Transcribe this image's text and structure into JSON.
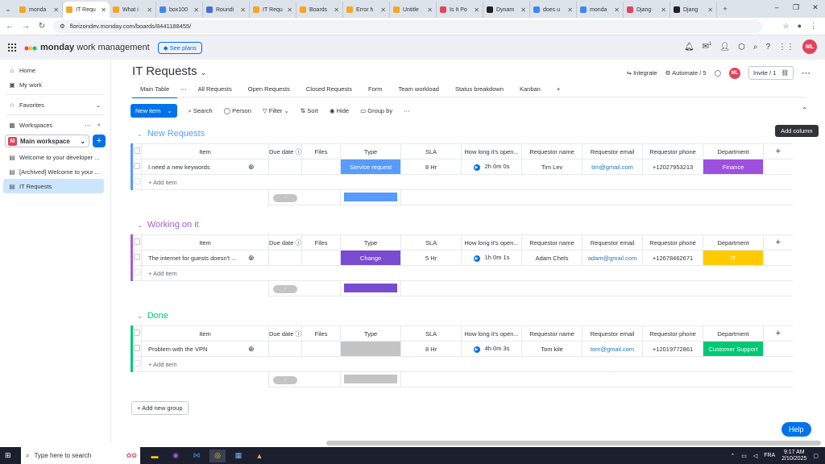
{
  "browser": {
    "tabs": [
      {
        "label": "monda",
        "color": "#f5a623"
      },
      {
        "label": "IT Requ",
        "color": "#f5a623",
        "active": true
      },
      {
        "label": "What i",
        "color": "#f5a623"
      },
      {
        "label": "box100",
        "color": "#4285f4"
      },
      {
        "label": "Roundi",
        "color": "#4b6bd6"
      },
      {
        "label": "IT Requ",
        "color": "#f5a623"
      },
      {
        "label": "Boards",
        "color": "#f5a623"
      },
      {
        "label": "Error h",
        "color": "#f5a623"
      },
      {
        "label": "Untitle",
        "color": "#f5a623"
      },
      {
        "label": "Is It Po",
        "color": "#e2445c"
      },
      {
        "label": "Dynam",
        "color": "#222"
      },
      {
        "label": "does u",
        "color": "#4285f4"
      },
      {
        "label": "monda",
        "color": "#4285f4"
      },
      {
        "label": "Djang",
        "color": "#e2445c"
      },
      {
        "label": "Djang",
        "color": "#222"
      }
    ],
    "url": "florizondev.monday.com/boards/8441188455/"
  },
  "app": {
    "logo_word": "monday",
    "logo_rest": "work management",
    "see_plans": "See plans",
    "avatar": "ML",
    "updates_badge": "1"
  },
  "sidebar": {
    "home": "Home",
    "my_work": "My work",
    "favorites": "Favorites",
    "workspaces": "Workspaces",
    "workspace": "Main workspace",
    "workspace_initial": "M",
    "boards": [
      "Welcome to your developer ...",
      "[Archived] Welcome to your ...",
      "IT Requests"
    ]
  },
  "board": {
    "title": "IT Requests",
    "integrate": "Integrate",
    "automate": "Automate / 5",
    "invite": "Invite / 1",
    "avatar": "ML",
    "views": [
      "Main Table",
      "All Requests",
      "Open Requests",
      "Closed Requests",
      "Form",
      "Team workload",
      "Status breakdown",
      "Kanban"
    ],
    "toolbar": {
      "new_item": "New item",
      "search": "Search",
      "person": "Person",
      "filter": "Filter",
      "sort": "Sort",
      "hide": "Hide",
      "group_by": "Group by"
    },
    "columns": [
      "Item",
      "Due date",
      "Files",
      "Type",
      "SLA",
      "How long it's open...",
      "Requestor name",
      "Requestor email",
      "Requestor phone",
      "Department"
    ],
    "add_item": "+ Add item",
    "add_column": "Add column",
    "add_group": "Add new group",
    "groups": [
      {
        "name": "New Requests",
        "color": "#579bfc",
        "rows": [
          {
            "item": "I need a new keywords",
            "type": "Service request",
            "type_color": "#579bfc",
            "sla": "8 Hr",
            "open": "2h 0m 0s",
            "name": "Tim Lev",
            "email": "tim@gmail.com",
            "phone": "+12027953213",
            "dept": "Finance",
            "dept_color": "#9d50dd"
          }
        ]
      },
      {
        "name": "Working on it",
        "color": "#a25ddc",
        "rows": [
          {
            "item": "The internet for guests doesn't ...",
            "type": "Change",
            "type_color": "#784bd1",
            "sla": "5 Hr",
            "open": "1h 0m 1s",
            "name": "Adam Chels",
            "email": "adam@gmail.com",
            "phone": "+12678462671",
            "dept": "IT",
            "dept_color": "#ffcb00"
          }
        ]
      },
      {
        "name": "Done",
        "color": "#00c875",
        "rows": [
          {
            "item": "Problem with the VPN",
            "type": "",
            "type_color": "#c4c4c4",
            "sla": "8 Hr",
            "open": "4h 0m 3s",
            "name": "Tom kile",
            "email": "tom@gmail.com",
            "phone": "+12019772861",
            "dept": "Customer Support",
            "dept_color": "#00c875"
          }
        ]
      }
    ]
  },
  "help": "Help",
  "taskbar": {
    "search": "Type here to search",
    "lang": "FRA",
    "time": "9:17 AM",
    "date": "2/10/2025"
  }
}
